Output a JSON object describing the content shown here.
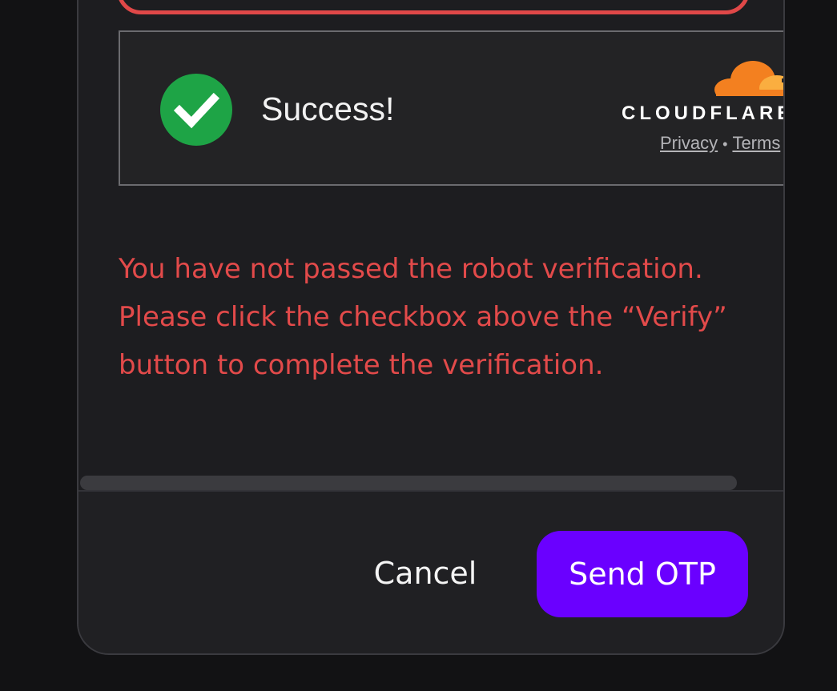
{
  "turnstile": {
    "status": "Success!",
    "brand": "CLOUDFLARE",
    "privacy_link": "Privacy",
    "separator": "•",
    "terms_link": "Terms"
  },
  "error": {
    "message": "You have not passed the robot verification. Please click the checkbox above the “Verify” button to complete the verification."
  },
  "footer": {
    "cancel_label": "Cancel",
    "send_label": "Send OTP"
  },
  "colors": {
    "error": "#e24a4a",
    "success": "#1ea446",
    "primary_button": "#6a00ff",
    "cloudflare_orange": "#f38020"
  },
  "icons": {
    "status": "checkmark-icon",
    "brand": "cloudflare-cloud-icon"
  }
}
